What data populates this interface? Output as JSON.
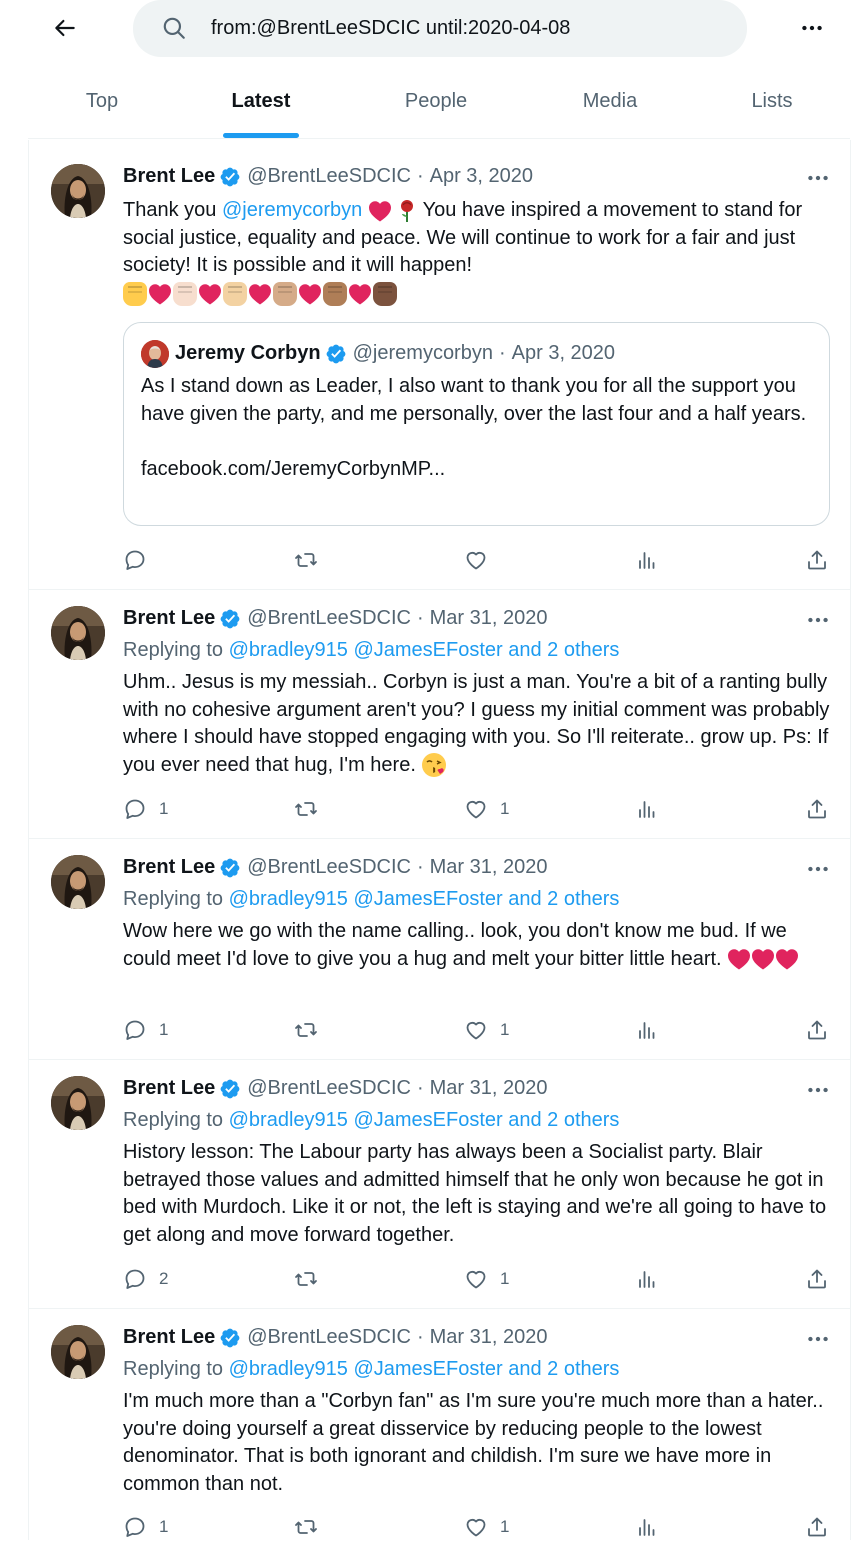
{
  "search": {
    "query": "from:@BrentLeeSDCIC until:2020-04-08"
  },
  "tabs": [
    {
      "label": "Top"
    },
    {
      "label": "Latest"
    },
    {
      "label": "People"
    },
    {
      "label": "Media"
    },
    {
      "label": "Lists"
    }
  ],
  "active_tab": "Latest",
  "colors": {
    "accent": "#1d9bf0",
    "muted": "#536471",
    "heart": "#e0245e"
  },
  "tweets": [
    {
      "name": "Brent Lee",
      "handle": "@BrentLeeSDCIC",
      "sep": "·",
      "date": "Apr 3, 2020",
      "text_before": "Thank you ",
      "mention": "@jeremycorbyn",
      "text_after": "You have inspired a movement to stand for social justice, equality and peace. We will continue to work for a fair and just society! It is possible and it will happen!",
      "emoji_row": [
        "raised-fist",
        "red-heart",
        "raised-fist",
        "red-heart",
        "raised-fist",
        "red-heart",
        "raised-fist",
        "red-heart",
        "raised-fist",
        "red-heart",
        "raised-fist"
      ],
      "quote": {
        "name": "Jeremy Corbyn",
        "handle": "@jeremycorbyn",
        "sep": "·",
        "date": "Apr 3, 2020",
        "text": "As I stand down as Leader, I also want to thank you for all the support you have given the party, and me personally, over the last four and a half years.",
        "link": "facebook.com/JeremyCorbynMP..."
      },
      "replies": "",
      "likes": ""
    },
    {
      "name": "Brent Lee",
      "handle": "@BrentLeeSDCIC",
      "sep": "·",
      "date": "Mar 31, 2020",
      "replying_label": "Replying to",
      "replying_to": "@bradley915 @JamesEFoster and 2 others",
      "text": "Uhm.. Jesus is my messiah.. Corbyn is just a man. You're a bit of a ranting bully with no cohesive argument aren't you? I guess my initial comment was probably where I should have stopped engaging with you. So I'll reiterate.. grow up. Ps: If you ever need that hug, I'm here.",
      "replies": "1",
      "likes": "1"
    },
    {
      "name": "Brent Lee",
      "handle": "@BrentLeeSDCIC",
      "sep": "·",
      "date": "Mar 31, 2020",
      "replying_label": "Replying to",
      "replying_to": "@bradley915 @JamesEFoster and 2 others",
      "text": "Wow here we go with the name calling.. look, you don't know me bud. If we could meet I'd love to give you a hug and melt your bitter little heart.",
      "replies": "1",
      "likes": "1"
    },
    {
      "name": "Brent Lee",
      "handle": "@BrentLeeSDCIC",
      "sep": "·",
      "date": "Mar 31, 2020",
      "replying_label": "Replying to",
      "replying_to": "@bradley915 @JamesEFoster and 2 others",
      "text": "History lesson: The Labour party has always been a Socialist party. Blair betrayed those values and admitted himself that he only won because he got in bed with Murdoch. Like it or not, the left is staying and we're all going to have to get along and move forward together.",
      "replies": "2",
      "likes": "1"
    },
    {
      "name": "Brent Lee",
      "handle": "@BrentLeeSDCIC",
      "sep": "·",
      "date": "Mar 31, 2020",
      "replying_label": "Replying to",
      "replying_to": "@bradley915 @JamesEFoster and 2 others",
      "text": "I'm much more than a \"Corbyn fan\" as I'm sure you're much more than a hater.. you're doing yourself a great disservice by reducing people to the lowest denominator. That is both ignorant and childish. I'm sure we have more in common than not.",
      "replies": "1",
      "likes": "1"
    }
  ]
}
